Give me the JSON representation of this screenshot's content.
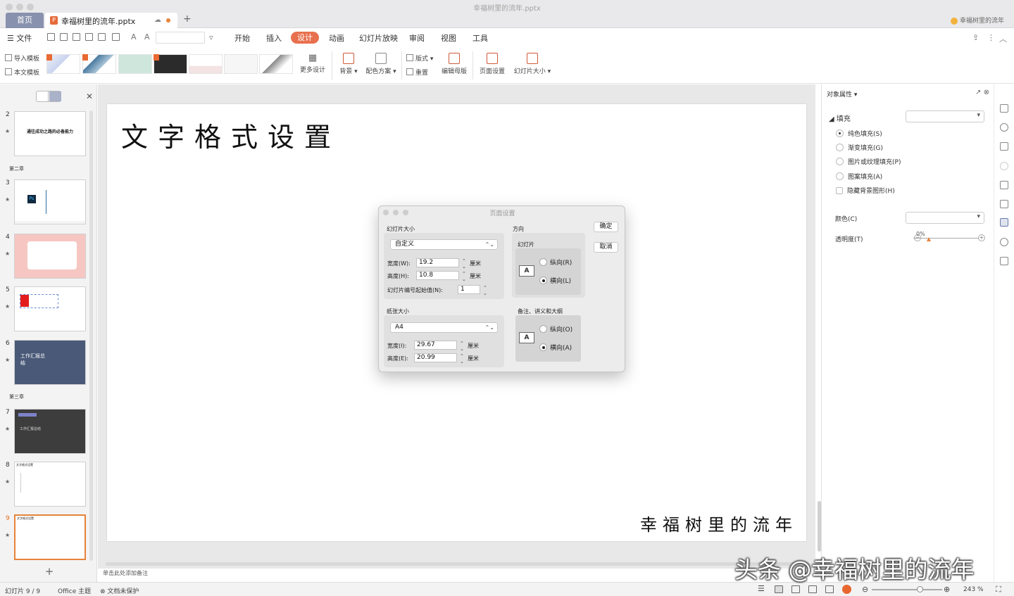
{
  "window": {
    "title": "幸福树里的流年.pptx",
    "home_tab": "首页",
    "doc_tab": "幸福树里的流年.pptx",
    "user_name": "幸福树里的流年"
  },
  "menu": {
    "file": "文件",
    "items": [
      "开始",
      "插入",
      "设计",
      "动画",
      "幻灯片放映",
      "审阅",
      "视图",
      "工具"
    ],
    "active": "设计"
  },
  "ribbon": {
    "import_template": "导入模板",
    "this_template": "本文模板",
    "more_design": "更多设计",
    "background": "背景",
    "color_scheme": "配色方案",
    "layout": "版式",
    "reset": "重置",
    "edit_master": "编辑母版",
    "page_setup": "页面设置",
    "slide_size": "幻灯片大小"
  },
  "slides_panel": {
    "section_2": "第二章",
    "section_3": "第三章",
    "slides": [
      {
        "num": "2",
        "text": "通往成功之路的必备能力"
      },
      {
        "num": "3",
        "text": "Ps"
      },
      {
        "num": "4",
        "text": ""
      },
      {
        "num": "5",
        "text": ""
      },
      {
        "num": "6",
        "text": "工作汇报总结"
      },
      {
        "num": "7",
        "text": "工作汇报总结"
      },
      {
        "num": "8",
        "text": "文字格式设置"
      },
      {
        "num": "9",
        "text": "文字格式设置"
      }
    ],
    "selected": "9"
  },
  "slide": {
    "title": "文字格式设置",
    "footer": "幸福树里的流年"
  },
  "notes_hint": "单击此处添加备注",
  "dialog": {
    "title": "页面设置",
    "slide_size_label": "幻灯片大小",
    "slide_size_value": "自定义",
    "width_label": "宽度(W):",
    "width_value": "19.2",
    "height_label": "高度(H):",
    "height_value": "10.8",
    "unit": "厘米",
    "start_num_label": "幻灯片编号起始值(N):",
    "start_num_value": "1",
    "paper_label": "纸张大小",
    "paper_value": "A4",
    "paper_width_label": "宽度(I):",
    "paper_width_value": "29.67",
    "paper_height_label": "高度(E):",
    "paper_height_value": "20.99",
    "orientation_label": "方向",
    "slides_label": "幻灯片",
    "portrait_r": "纵向(R)",
    "landscape_l": "横向(L)",
    "notes_label": "备注、讲义和大纲",
    "portrait_o": "纵向(O)",
    "landscape_a": "横向(A)",
    "ok": "确定",
    "cancel": "取消"
  },
  "properties": {
    "title": "对象属性",
    "fill": "填充",
    "options": [
      "纯色填充(S)",
      "渐变填充(G)",
      "图片或纹理填充(P)",
      "图案填充(A)"
    ],
    "selected_option": "纯色填充(S)",
    "hide_bg": "隐藏背景图形(H)",
    "color": "颜色(C)",
    "transparency": "透明度(T)",
    "transparency_value": "0%",
    "transparency_fraction": 0
  },
  "status": {
    "slide_counter": "幻灯片 9 / 9",
    "theme": "Office 主题",
    "protect": "文档未保护",
    "zoom": "243 %"
  },
  "watermark": "头条 @幸福树里的流年",
  "colors": {
    "accent": "#e8704e",
    "home_tab": "#8891ad",
    "play": "#e8662f"
  }
}
